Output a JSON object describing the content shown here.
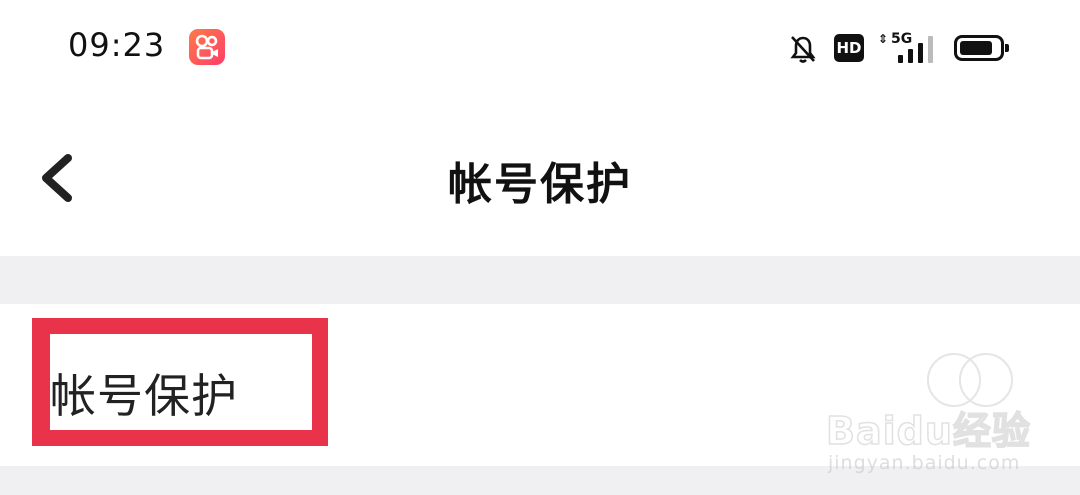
{
  "status_bar": {
    "time": "09:23",
    "app_icon": "kuaishou-app-icon",
    "hd_label": "HD",
    "network_label": "5G",
    "network_arrows": "⇕",
    "notification_icon": "bell-off-icon",
    "signal_icon": "signal-bars-icon",
    "battery_icon": "battery-icon",
    "battery_level": 0.85
  },
  "nav": {
    "back_icon": "chevron-left-icon",
    "title": "帐号保护"
  },
  "settings": {
    "items": [
      {
        "label": "帐号保护"
      }
    ]
  },
  "annotation": {
    "highlight_color": "#e8334a"
  },
  "watermark": {
    "logo": "Baidu经验",
    "url": "jingyan.baidu.com"
  }
}
